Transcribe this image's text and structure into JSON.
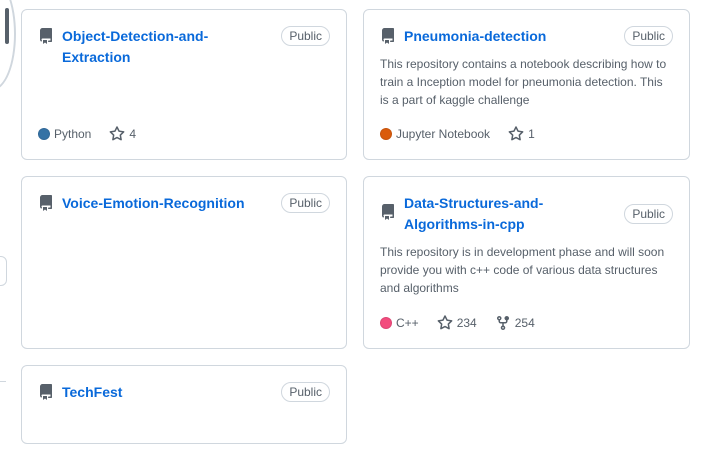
{
  "colors": {
    "link": "#0969da",
    "python": "#3572A5",
    "jupyter": "#DA5B0B",
    "cpp": "#f34b7d"
  },
  "repos": [
    {
      "name": "Object-Detection-and-Extraction",
      "visibility": "Public",
      "description": "",
      "language": "Python",
      "language_color": "#3572A5",
      "stars": "4",
      "forks": ""
    },
    {
      "name": "Pneumonia-detection",
      "visibility": "Public",
      "description": "This repository contains a notebook describing how to train a Inception model for pneumonia detection. This is a part of kaggle challenge",
      "language": "Jupyter Notebook",
      "language_color": "#DA5B0B",
      "stars": "1",
      "forks": ""
    },
    {
      "name": "Voice-Emotion-Recognition",
      "visibility": "Public",
      "description": "",
      "language": "",
      "stars": "",
      "forks": ""
    },
    {
      "name": "Data-Structures-and-Algorithms-in-cpp",
      "visibility": "Public",
      "description": "This repository is in development phase and will soon provide you with c++ code of various data structures and algorithms",
      "language": "C++",
      "language_color": "#f34b7d",
      "stars": "234",
      "forks": "254"
    },
    {
      "name": "TechFest",
      "visibility": "Public",
      "description": "",
      "language": "",
      "stars": "",
      "forks": ""
    }
  ]
}
